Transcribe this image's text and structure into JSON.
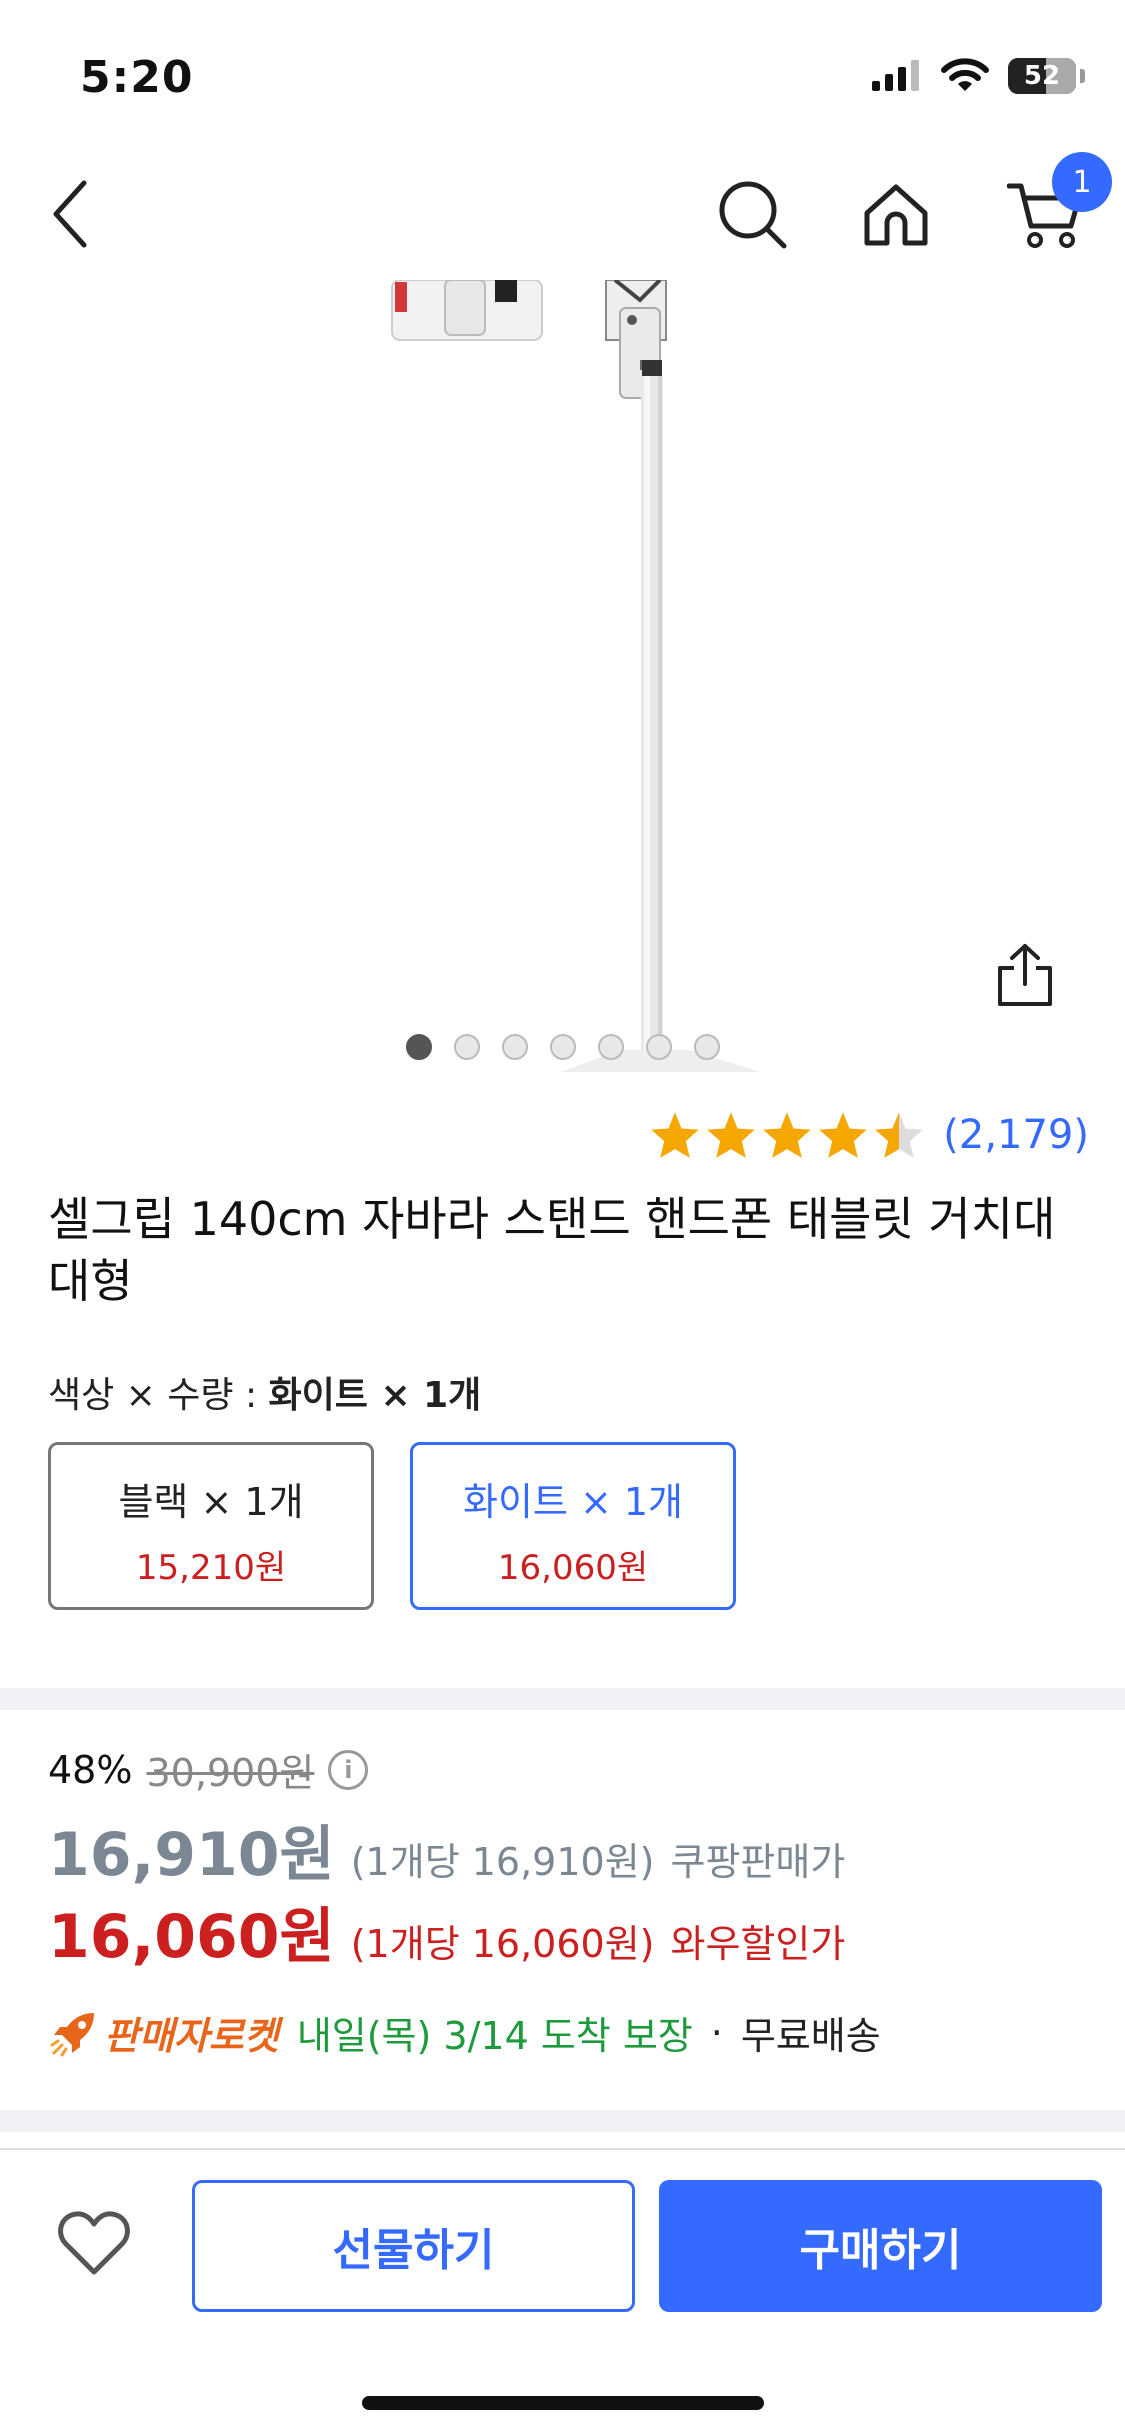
{
  "status_bar": {
    "time": "5:20",
    "battery": "52"
  },
  "nav": {
    "cart_count": "1",
    "icons": [
      "back-icon",
      "search-icon",
      "home-icon",
      "cart-icon"
    ]
  },
  "carousel": {
    "total": 7,
    "active": 1
  },
  "rating": {
    "stars": 4.5,
    "count": "(2,179)"
  },
  "product": {
    "title": "셀그립 140cm 자바라 스탠드 핸드폰 태블릿 거치대 대형"
  },
  "options": {
    "label_prefix": "색상 × 수량 : ",
    "selected_value": "화이트 × 1개",
    "items": [
      {
        "name": "블랙 × 1개",
        "price": "15,210원",
        "selected": false
      },
      {
        "name": "화이트 × 1개",
        "price": "16,060원",
        "selected": true
      }
    ]
  },
  "pricing": {
    "discount_rate": "48%",
    "original_price": "30,900원",
    "info_icon": "i",
    "coupang_price": "16,910원",
    "coupang_unit": "(1개당 16,910원)",
    "coupang_label": "쿠팡판매가",
    "wow_price": "16,060원",
    "wow_unit": "(1개당 16,060원)",
    "wow_label": "와우할인가"
  },
  "delivery": {
    "badge": "판매자로켓",
    "date": "내일(목) 3/14 도착 보장",
    "separator": "·",
    "shipping": "무료배송"
  },
  "actions": {
    "gift": "선물하기",
    "buy": "구매하기"
  },
  "colors": {
    "accent": "#346aff",
    "sale": "#cc1f1f",
    "delivery": "#1d9a3b",
    "rocket": "#e8661b"
  }
}
